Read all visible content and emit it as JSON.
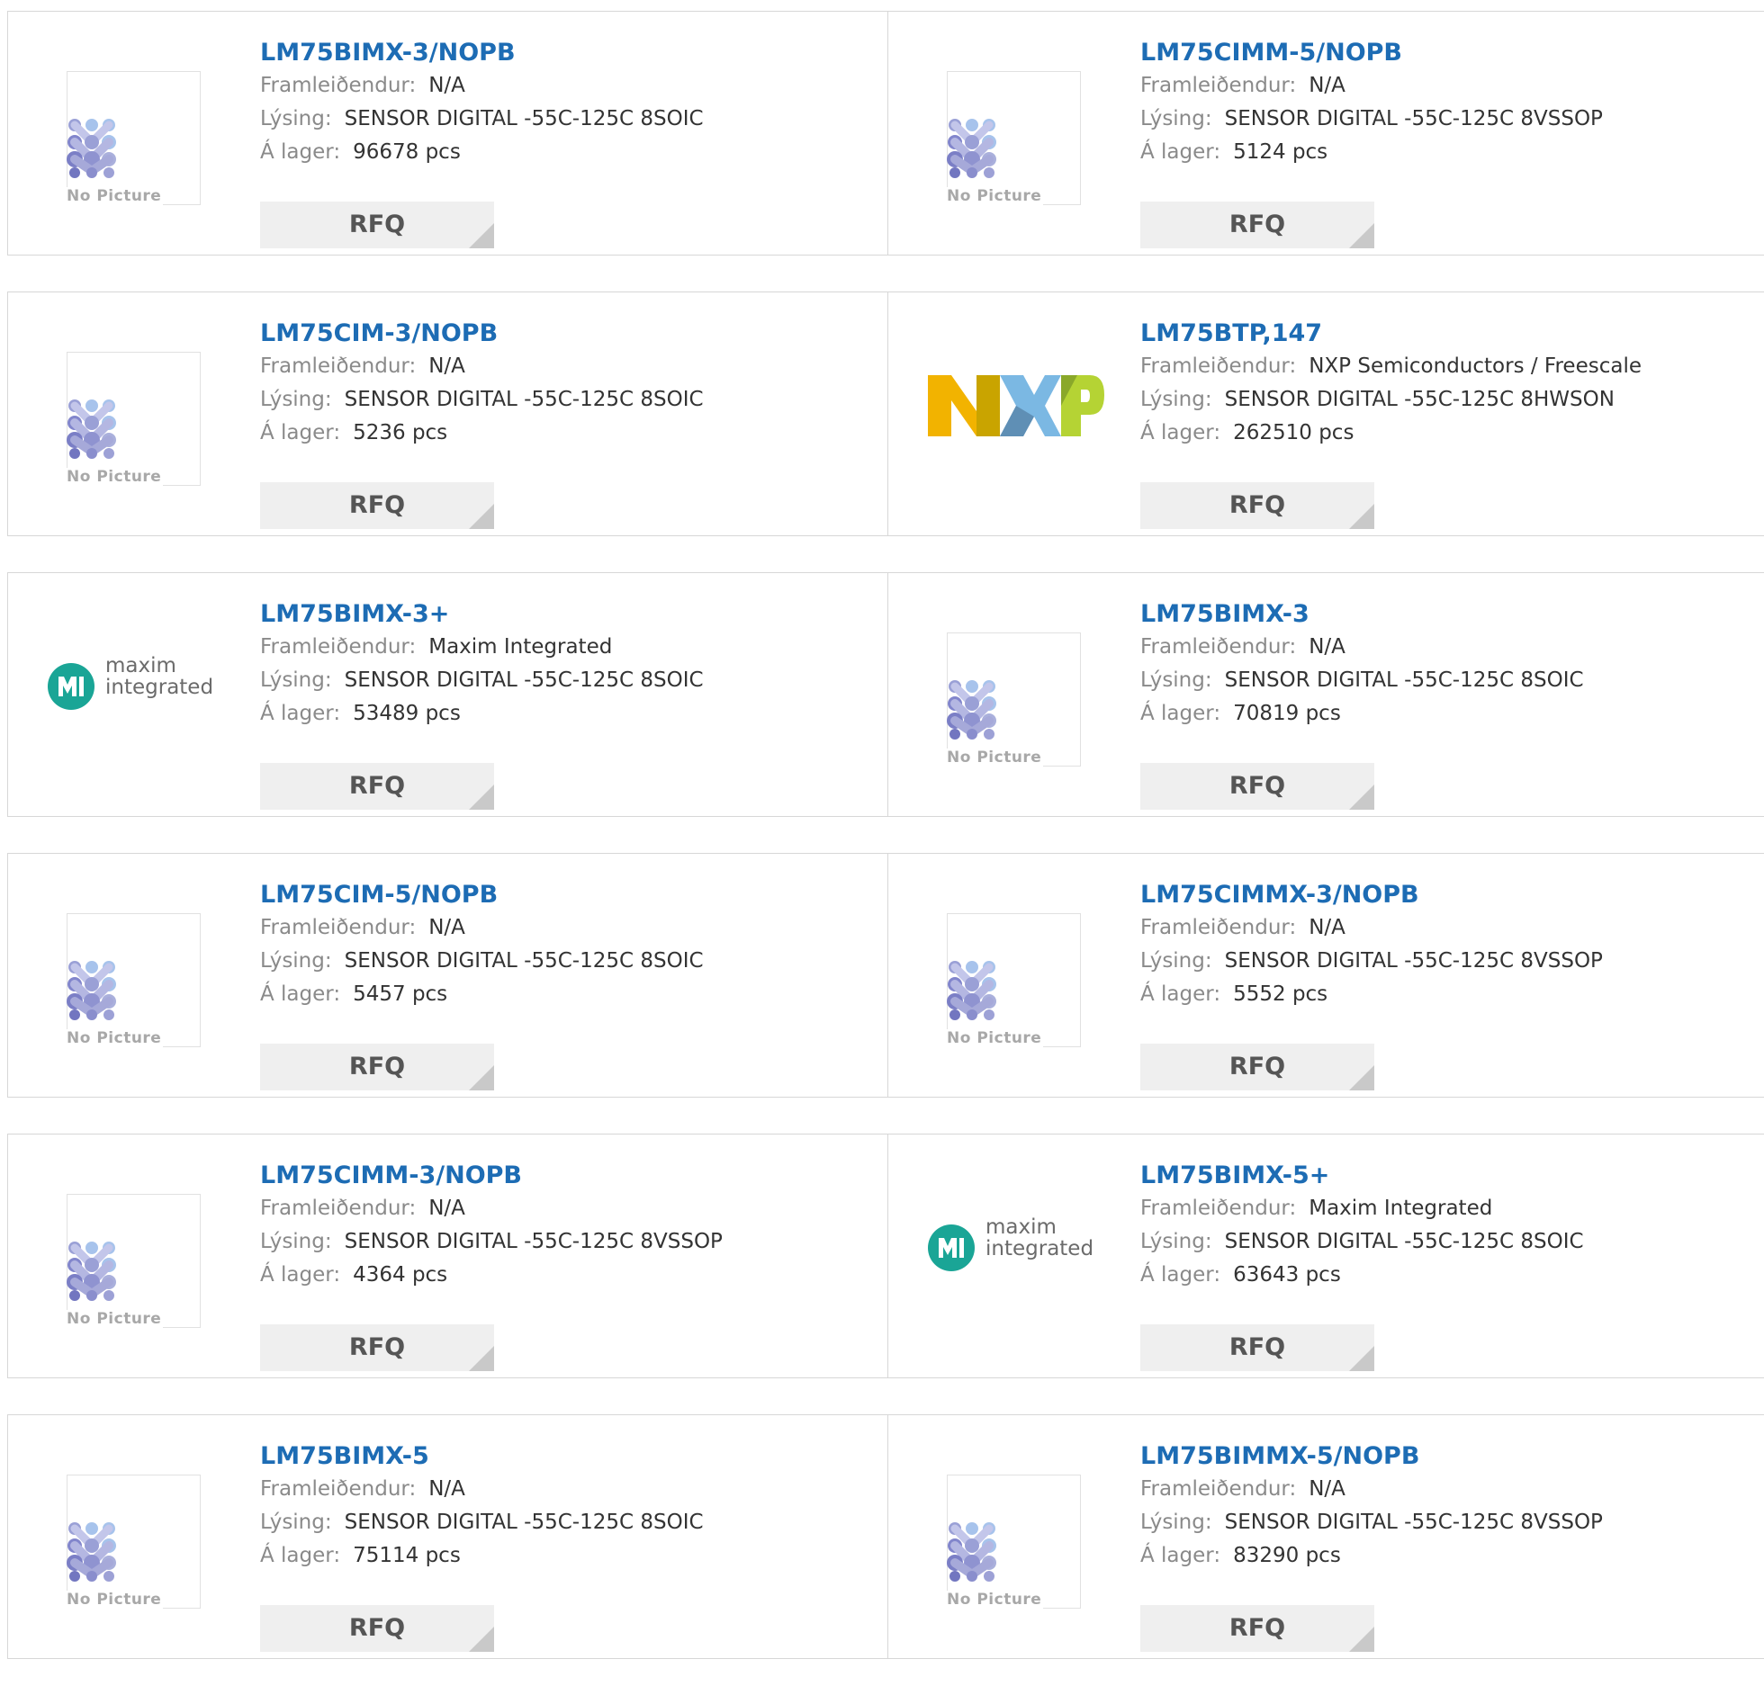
{
  "labels": {
    "manufacturer": "Framleiðendur:",
    "description": "Lýsing:",
    "stock": "Á lager:",
    "rfq": "RFQ",
    "no_picture": "No Picture"
  },
  "colors": {
    "link": "#1d6cb4",
    "label": "#8a8a8a",
    "value": "#333333",
    "button_bg": "#efefef",
    "card_border": "#d7d7d7"
  },
  "logo_text": {
    "nxp": "NXP",
    "maxim_line1": "maxim",
    "maxim_line2": "integrated"
  },
  "products": [
    {
      "part": "LM75BIMX-3/NOPB",
      "manufacturer": "N/A",
      "description": "SENSOR DIGITAL -55C-125C 8SOIC",
      "stock": "96678 pcs",
      "image": "no-picture"
    },
    {
      "part": "LM75CIMM-5/NOPB",
      "manufacturer": "N/A",
      "description": "SENSOR DIGITAL -55C-125C 8VSSOP",
      "stock": "5124 pcs",
      "image": "no-picture"
    },
    {
      "part": "LM75CIM-3/NOPB",
      "manufacturer": "N/A",
      "description": "SENSOR DIGITAL -55C-125C 8SOIC",
      "stock": "5236 pcs",
      "image": "no-picture"
    },
    {
      "part": "LM75BTP,147",
      "manufacturer": "NXP Semiconductors / Freescale",
      "description": "SENSOR DIGITAL -55C-125C 8HWSON",
      "stock": "262510 pcs",
      "image": "nxp-logo"
    },
    {
      "part": "LM75BIMX-3+",
      "manufacturer": "Maxim Integrated",
      "description": "SENSOR DIGITAL -55C-125C 8SOIC",
      "stock": "53489 pcs",
      "image": "maxim-logo"
    },
    {
      "part": "LM75BIMX-3",
      "manufacturer": "N/A",
      "description": "SENSOR DIGITAL -55C-125C 8SOIC",
      "stock": "70819 pcs",
      "image": "no-picture"
    },
    {
      "part": "LM75CIM-5/NOPB",
      "manufacturer": "N/A",
      "description": "SENSOR DIGITAL -55C-125C 8SOIC",
      "stock": "5457 pcs",
      "image": "no-picture"
    },
    {
      "part": "LM75CIMMX-3/NOPB",
      "manufacturer": "N/A",
      "description": "SENSOR DIGITAL -55C-125C 8VSSOP",
      "stock": "5552 pcs",
      "image": "no-picture"
    },
    {
      "part": "LM75CIMM-3/NOPB",
      "manufacturer": "N/A",
      "description": "SENSOR DIGITAL -55C-125C 8VSSOP",
      "stock": "4364 pcs",
      "image": "no-picture"
    },
    {
      "part": "LM75BIMX-5+",
      "manufacturer": "Maxim Integrated",
      "description": "SENSOR DIGITAL -55C-125C 8SOIC",
      "stock": "63643 pcs",
      "image": "maxim-logo"
    },
    {
      "part": "LM75BIMX-5",
      "manufacturer": "N/A",
      "description": "SENSOR DIGITAL -55C-125C 8SOIC",
      "stock": "75114 pcs",
      "image": "no-picture"
    },
    {
      "part": "LM75BIMMX-5/NOPB",
      "manufacturer": "N/A",
      "description": "SENSOR DIGITAL -55C-125C 8VSSOP",
      "stock": "83290 pcs",
      "image": "no-picture"
    }
  ]
}
